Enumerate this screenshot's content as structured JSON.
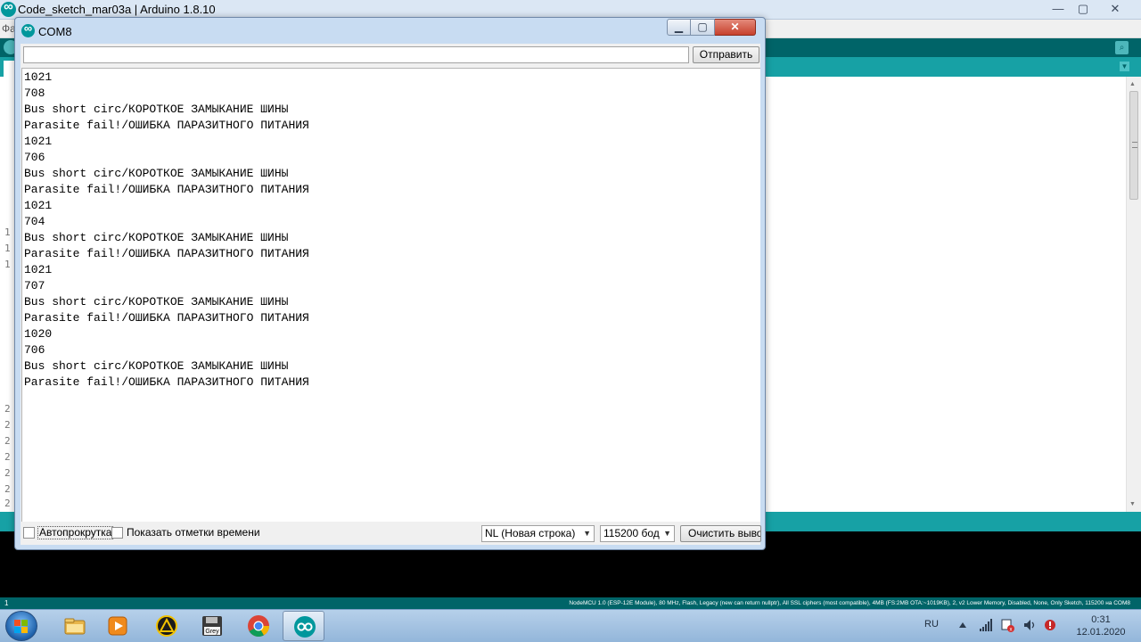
{
  "ide": {
    "title": "Code_sketch_mar03a | Arduino 1.8.10",
    "menu_label": "Фа",
    "controls": {
      "minimize": "—",
      "maximize": "▢",
      "close": "✕"
    },
    "gutter": [
      "1",
      "1",
      "1",
      "2",
      "2",
      "2",
      "2",
      "2",
      "2",
      "2"
    ],
    "footer_line": "1",
    "board_info": "NodeMCU 1.0 (ESP-12E Module), 80 MHz, Flash, Legacy (new can return nullptr), All SSL ciphers (most compatible), 4MB (FS:2MB OTA:~1019KB), 2, v2 Lower Memory, Disabled, None, Only Sketch, 115200 на COM8",
    "scroll_grip_icon": "grip-icon"
  },
  "serial": {
    "title": "COM8",
    "send_label": "Отправить",
    "input_value": "",
    "output": [
      "1021",
      "708",
      "Bus short circ/КОРОТКОЕ ЗАМЫКАНИЕ ШИНЫ",
      "Parasite fail!/ОШИБКА ПАРАЗИТНОГО ПИТАНИЯ",
      "1021",
      "706",
      "Bus short circ/КОРОТКОЕ ЗАМЫКАНИЕ ШИНЫ",
      "Parasite fail!/ОШИБКА ПАРАЗИТНОГО ПИТАНИЯ",
      "1021",
      "704",
      "Bus short circ/КОРОТКОЕ ЗАМЫКАНИЕ ШИНЫ",
      "Parasite fail!/ОШИБКА ПАРАЗИТНОГО ПИТАНИЯ",
      "1021",
      "707",
      "Bus short circ/КОРОТКОЕ ЗАМЫКАНИЕ ШИНЫ",
      "Parasite fail!/ОШИБКА ПАРАЗИТНОГО ПИТАНИЯ",
      "1020",
      "706",
      "Bus short circ/КОРОТКОЕ ЗАМЫКАНИЕ ШИНЫ",
      "Parasite fail!/ОШИБКА ПАРАЗИТНОГО ПИТАНИЯ"
    ],
    "autoscroll_label": "Автопрокрутка",
    "autoscroll_checked": false,
    "timestamp_label": "Показать отметки времени",
    "timestamp_checked": false,
    "line_ending": "NL (Новая строка)",
    "baud": "115200 бод",
    "clear_label": "Очистить вывод"
  },
  "taskbar": {
    "apps": [
      {
        "name": "explorer-icon"
      },
      {
        "name": "media-player-icon"
      },
      {
        "name": "archive-app-icon"
      },
      {
        "name": "floppy-grey-icon",
        "label": "Grey"
      },
      {
        "name": "chrome-icon"
      },
      {
        "name": "arduino-icon",
        "active": true
      }
    ],
    "lang": "RU",
    "time": "0:31",
    "date": "12.01.2020"
  },
  "colors": {
    "arduino_teal": "#006468",
    "arduino_light": "#17a1a5",
    "window_frame": "#c8dcf2",
    "close_red": "#c7412d"
  }
}
